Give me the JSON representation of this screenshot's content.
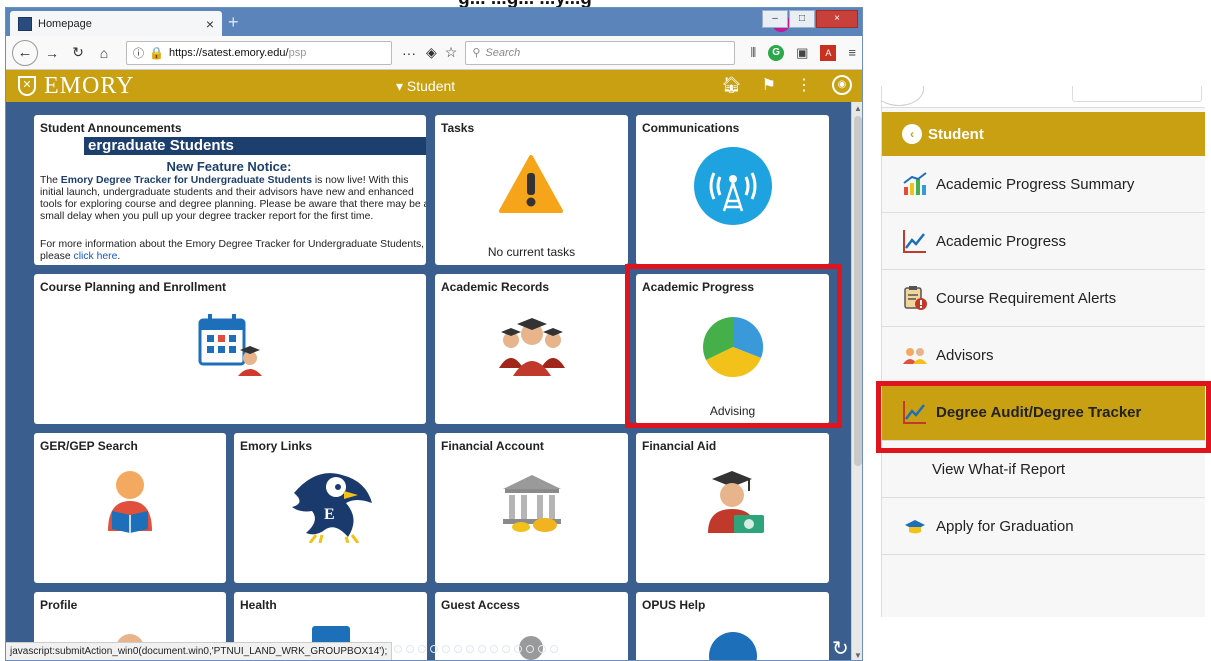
{
  "heading_partial": "g...                    ...g...       ...y...g",
  "browser": {
    "tab_title": "Homepage",
    "tab_close": "×",
    "new_tab": "+",
    "url_host": "https://satest.emory.edu/",
    "url_path": "psp",
    "page_actions": "···",
    "search_placeholder": "Search",
    "win_min": "–",
    "win_max": "□",
    "win_close": "×",
    "status_text": "javascript:submitAction_win0(document.win0,'PTNUI_LAND_WRK_GROUPBOX14');"
  },
  "emory_bar": {
    "logo_text": "EMORY",
    "menu_label": "▾ Student"
  },
  "tiles": {
    "announcements": {
      "title": "Student Announcements",
      "banner": "ergraduate Students",
      "notice_title": "New Feature Notice:",
      "body_prefix": "The ",
      "body_bold": "Emory Degree Tracker for Undergraduate Students",
      "body_rest": " is now live! With this initial launch, undergraduate students and their advisors have new and enhanced tools for exploring course and degree planning. Please be aware that there may be a small delay when you pull up your degree tracker report for the first time.",
      "more_text": "For more information about the Emory Degree Tracker for Undergraduate Students, please ",
      "more_link": "click here",
      "more_end": "."
    },
    "tasks": {
      "title": "Tasks",
      "footer": "No current tasks"
    },
    "communications": {
      "title": "Communications"
    },
    "course_planning": {
      "title": "Course Planning and Enrollment"
    },
    "academic_records": {
      "title": "Academic Records"
    },
    "academic_progress": {
      "title": "Academic Progress",
      "footer": "Advising"
    },
    "ger_search": {
      "title": "GER/GEP Search"
    },
    "emory_links": {
      "title": "Emory Links"
    },
    "financial_account": {
      "title": "Financial Account"
    },
    "financial_aid": {
      "title": "Financial Aid"
    },
    "profile": {
      "title": "Profile"
    },
    "health": {
      "title": "Health"
    },
    "guest_access": {
      "title": "Guest Access"
    },
    "opus_help": {
      "title": "OPUS Help"
    }
  },
  "panel": {
    "header": "Student",
    "items": [
      {
        "label": "Academic Progress Summary"
      },
      {
        "label": "Academic Progress"
      },
      {
        "label": "Course Requirement Alerts"
      },
      {
        "label": "Advisors"
      },
      {
        "label": "Degree Audit/Degree Tracker"
      },
      {
        "label": "View What-if Report"
      },
      {
        "label": "Apply for Graduation"
      }
    ]
  },
  "colors": {
    "emory_gold": "#c8a012",
    "portal_blue": "#3a5f8f",
    "highlight_red": "#e0141c"
  }
}
